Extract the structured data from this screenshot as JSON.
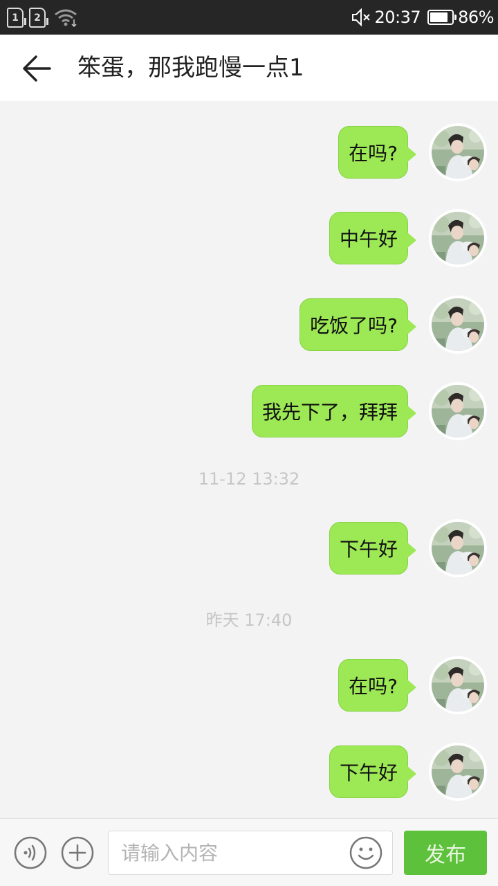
{
  "status_bar": {
    "sim1": "1",
    "sim2": "2",
    "time": "20:37",
    "battery": "86%",
    "battery_level": 0.86
  },
  "header": {
    "title": "笨蛋，那我跑慢一点1"
  },
  "messages": [
    {
      "type": "message",
      "text": "在吗?"
    },
    {
      "type": "message",
      "text": "中午好"
    },
    {
      "type": "message",
      "text": "吃饭了吗?"
    },
    {
      "type": "message",
      "text": "我先下了，拜拜"
    },
    {
      "type": "timestamp",
      "text": "11-12 13:32"
    },
    {
      "type": "message",
      "text": "下午好"
    },
    {
      "type": "timestamp",
      "text": "昨天 17:40"
    },
    {
      "type": "message",
      "text": "在吗?"
    },
    {
      "type": "message",
      "text": "下午好"
    }
  ],
  "input_bar": {
    "placeholder": "请输入内容",
    "send_label": "发布"
  },
  "colors": {
    "bubble": "#9de855",
    "send_button": "#5ec13c",
    "status_bar": "#262626"
  }
}
